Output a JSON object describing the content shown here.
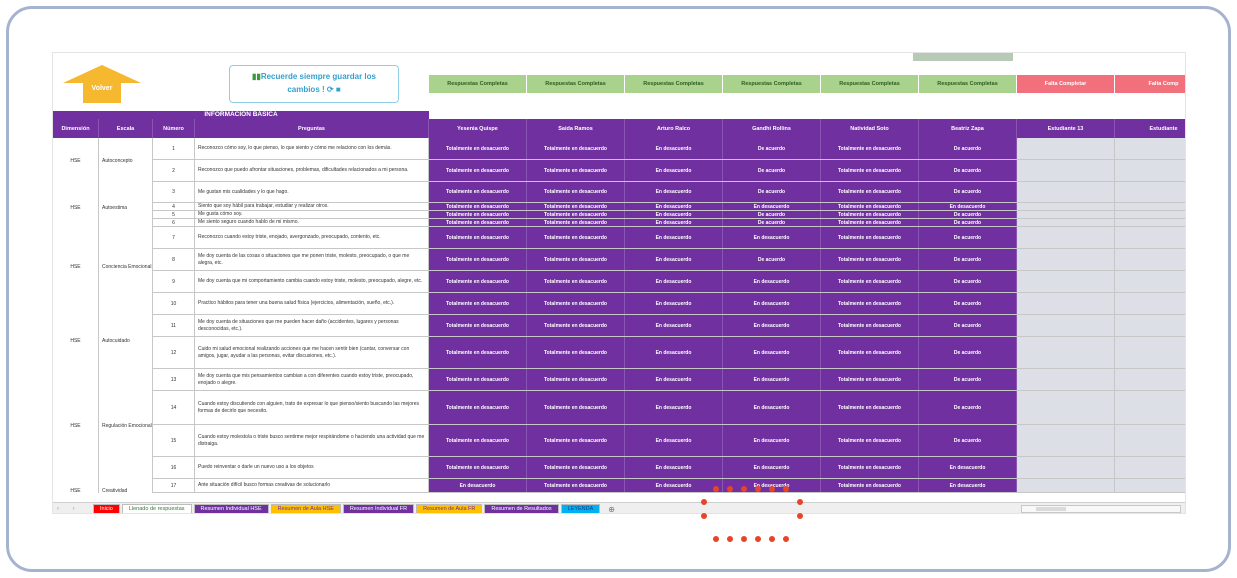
{
  "toolbar": {
    "back_label": "Volver",
    "reminder_line1": "Recuerde siempre guardar los",
    "reminder_line2": "cambios !",
    "status": [
      "Respuestas Completas",
      "Respuestas Completas",
      "Respuestas Completas",
      "Respuestas Completas",
      "Respuestas Completas",
      "Respuestas Completas",
      "Falta Completar",
      "Falta Comp"
    ]
  },
  "section_title": "INFORMACIÓN BÁSICA",
  "headers": {
    "dimension": "Dimensión",
    "escala": "Escala",
    "numero": "Número",
    "preguntas": "Preguntas",
    "students": [
      "Yesenia Quispe",
      "Saida Ramos",
      "Arturo Ralco",
      "Gandhi Rollins",
      "Natividad Soto",
      "Beatriz Zapa",
      "Estudiante 13",
      "Estudiante"
    ]
  },
  "rows": [
    {
      "num": "1",
      "q": "Reconozco cómo soy, lo que pienso, lo que siento y cómo me relaciono con los demás.",
      "h": 22,
      "a": [
        "Totalmente en desacuerdo",
        "Totalmente en desacuerdo",
        "En desacuerdo",
        "De acuerdo",
        "Totalmente en desacuerdo",
        "De acuerdo"
      ]
    },
    {
      "num": "2",
      "q": "Reconozco que puedo afrontar situaciones, problemas, dificultades relacionados a mi persona.",
      "h": 22,
      "a": [
        "Totalmente en desacuerdo",
        "Totalmente en desacuerdo",
        "En desacuerdo",
        "De acuerdo",
        "Totalmente en desacuerdo",
        "De acuerdo"
      ]
    },
    {
      "num": "3",
      "q": "Me gustan mis cualidades y lo que hago.",
      "h": 21,
      "a": [
        "Totalmente en desacuerdo",
        "Totalmente en desacuerdo",
        "En desacuerdo",
        "De acuerdo",
        "Totalmente en desacuerdo",
        "De acuerdo"
      ]
    },
    {
      "num": "4",
      "q": "Siento que soy hábil para trabajar, estudiar y realizar otros.",
      "h": 8,
      "a": [
        "Totalmente en desacuerdo",
        "Totalmente en desacuerdo",
        "En desacuerdo",
        "En desacuerdo",
        "Totalmente en desacuerdo",
        "En desacuerdo"
      ]
    },
    {
      "num": "5",
      "q": "Me gusta cómo soy.",
      "h": 8,
      "a": [
        "Totalmente en desacuerdo",
        "Totalmente en desacuerdo",
        "En desacuerdo",
        "De acuerdo",
        "Totalmente en desacuerdo",
        "De acuerdo"
      ]
    },
    {
      "num": "6",
      "q": "Me siento seguro cuando hablo de mi mismo.",
      "h": 8,
      "a": [
        "Totalmente en desacuerdo",
        "Totalmente en desacuerdo",
        "En desacuerdo",
        "De acuerdo",
        "Totalmente en desacuerdo",
        "De acuerdo"
      ]
    },
    {
      "num": "7",
      "q": "Reconozco cuando estoy triste, enojado, avergonzado, preocupado, contento, etc.",
      "h": 22,
      "a": [
        "Totalmente en desacuerdo",
        "Totalmente en desacuerdo",
        "En desacuerdo",
        "En desacuerdo",
        "Totalmente en desacuerdo",
        "De acuerdo"
      ]
    },
    {
      "num": "8",
      "q": "Me doy cuenta de las cosas o situaciones que me ponen triste, molesto, preocupado, o que me alegra, etc.",
      "h": 22,
      "a": [
        "Totalmente en desacuerdo",
        "Totalmente en desacuerdo",
        "En desacuerdo",
        "De acuerdo",
        "Totalmente en desacuerdo",
        "De acuerdo"
      ]
    },
    {
      "num": "9",
      "q": "Me doy cuenta que mi comportamiento cambia cuando estoy triste, molesto, preocupado, alegre, etc.",
      "h": 22,
      "a": [
        "Totalmente en desacuerdo",
        "Totalmente en desacuerdo",
        "En desacuerdo",
        "En desacuerdo",
        "Totalmente en desacuerdo",
        "De acuerdo"
      ]
    },
    {
      "num": "10",
      "q": "Practico hábitos para tener una buena salud física (ejercicios, alimentación, sueño, etc.).",
      "h": 22,
      "a": [
        "Totalmente en desacuerdo",
        "Totalmente en desacuerdo",
        "En desacuerdo",
        "En desacuerdo",
        "Totalmente en desacuerdo",
        "De acuerdo"
      ]
    },
    {
      "num": "11",
      "q": "Me doy cuenta de situaciones que me pueden hacer daño (accidentes, lugares y personas desconocidas, etc.).",
      "h": 22,
      "a": [
        "Totalmente en desacuerdo",
        "Totalmente en desacuerdo",
        "En desacuerdo",
        "En desacuerdo",
        "Totalmente en desacuerdo",
        "De acuerdo"
      ]
    },
    {
      "num": "12",
      "q": "Cuido mi salud emocional realizando acciones que me hacen sentir bien (cantar, conversar con amigos, jugar, ayudar a las personas, evitar discusiones, etc.).",
      "h": 32,
      "a": [
        "Totalmente en desacuerdo",
        "Totalmente en desacuerdo",
        "En desacuerdo",
        "En desacuerdo",
        "Totalmente en desacuerdo",
        "De acuerdo"
      ]
    },
    {
      "num": "13",
      "q": "Me doy cuenta que mis pensamientos cambian a con diferentes cuando estoy triste, preocupado, enojado o alegre.",
      "h": 22,
      "a": [
        "Totalmente en desacuerdo",
        "Totalmente en desacuerdo",
        "En desacuerdo",
        "En desacuerdo",
        "Totalmente en desacuerdo",
        "De acuerdo"
      ]
    },
    {
      "num": "14",
      "q": "Cuando estoy discutiendo con alguien, trato de expresar lo que pienso/siento buscando las mejores formas de decirlo que necesito.",
      "h": 34,
      "a": [
        "Totalmente en desacuerdo",
        "Totalmente en desacuerdo",
        "En desacuerdo",
        "En desacuerdo",
        "Totalmente en desacuerdo",
        "De acuerdo"
      ]
    },
    {
      "num": "15",
      "q": "Cuando estoy molesto/a o triste busco sentirme mejor respirándome o haciendo una actividad que me distraiga.",
      "h": 32,
      "a": [
        "Totalmente en desacuerdo",
        "Totalmente en desacuerdo",
        "En desacuerdo",
        "En desacuerdo",
        "Totalmente en desacuerdo",
        "De acuerdo"
      ]
    },
    {
      "num": "16",
      "q": "Puedo reinventar o darle un nuevo uso a los objetos",
      "h": 22,
      "a": [
        "Totalmente en desacuerdo",
        "Totalmente en desacuerdo",
        "En desacuerdo",
        "En desacuerdo",
        "Totalmente en desacuerdo",
        "En desacuerdo"
      ]
    },
    {
      "num": "17",
      "q": "Ante situación difícil busco formas creativas de solucionarlo",
      "h": 14,
      "a": [
        "En desacuerdo",
        "Totalmente en desacuerdo",
        "En desacuerdo",
        "En desacuerdo",
        "Totalmente en desacuerdo",
        "En desacuerdo"
      ]
    }
  ],
  "groups": [
    {
      "dim": "HSE",
      "esc": "Autoconcepto"
    },
    {
      "dim": "HSE",
      "esc": "Autoestima"
    },
    {
      "dim": "HSE",
      "esc": "Conciencia Emocional"
    },
    {
      "dim": "HSE",
      "esc": "Autocuidado"
    },
    {
      "dim": "HSE",
      "esc": "Regulación Emocional"
    },
    {
      "dim": "HSE",
      "esc": "Creatividad"
    }
  ],
  "sheet_tabs": [
    {
      "label": "Inicio",
      "bg": "#ff0000",
      "fg": "#ffffff"
    },
    {
      "label": "Llenado de respuestas",
      "bg": "#ffffff",
      "fg": "#2e7d32"
    },
    {
      "label": "Resumen Individual HSE",
      "bg": "#7030a0",
      "fg": "#ffffff"
    },
    {
      "label": "Resumen de Aula HSE",
      "bg": "#ffc000",
      "fg": "#7030a0"
    },
    {
      "label": "Resumen Individual FR",
      "bg": "#7030a0",
      "fg": "#ffffff"
    },
    {
      "label": "Resumen de Aula FR",
      "bg": "#ffc000",
      "fg": "#7030a0"
    },
    {
      "label": "Resumen de Resultados",
      "bg": "#7030a0",
      "fg": "#ffffff"
    },
    {
      "label": "LEYENDA",
      "bg": "#00b0f0",
      "fg": "#1a3a8a"
    }
  ]
}
